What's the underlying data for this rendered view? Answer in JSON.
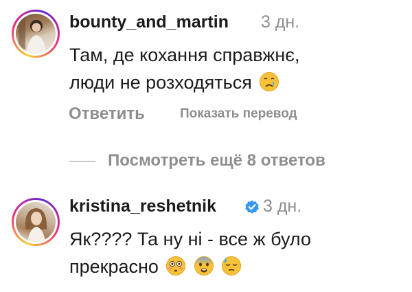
{
  "comments": [
    {
      "username": "bounty_and_martin",
      "time": "3 дн.",
      "text_line1": "Там, де кохання справжнє,",
      "text_line2": "люди не розходяться",
      "emojis": [
        "crying-face"
      ]
    },
    {
      "username": "kristina_reshetnik",
      "verified": true,
      "time": "3 дн.",
      "text_line1": "Як???? Та ну ні - все ж було",
      "text_line2": "прекрасно",
      "emojis": [
        "flushed-face",
        "fearful-face",
        "downcast-face-with-sweat"
      ]
    }
  ],
  "actions": {
    "reply_label": "Ответить",
    "translate_label": "Показать перевод"
  },
  "more_replies": {
    "label": "Посмотреть ещё 8 ответов"
  },
  "colors": {
    "primary_text": "#1b1b1b",
    "secondary_text": "#8e8e8e",
    "verified_blue": "#3897f0",
    "divider": "#c7c7c7"
  }
}
